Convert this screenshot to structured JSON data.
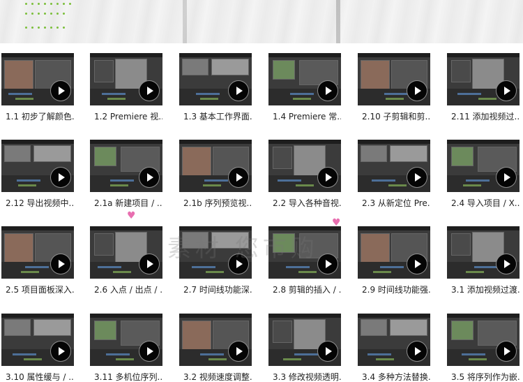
{
  "colors": {
    "accent_dots": "#7bbf3a",
    "play_button": "#050505",
    "thumb_bg": "#3b3b3b",
    "caption": "#222222"
  },
  "icons": {
    "play": "play-icon",
    "heart": "heart-icon"
  },
  "lessons": [
    {
      "title": "1.1 初步了解颜色..."
    },
    {
      "title": "1.2 Premiere 视..."
    },
    {
      "title": "1.3 基本工作界面..."
    },
    {
      "title": "1.4 Premiere 常..."
    },
    {
      "title": "2.10 子剪辑和剪..."
    },
    {
      "title": "2.11 添加视频过..."
    },
    {
      "title": "2.12 导出视频中..."
    },
    {
      "title": "2.1a 新建项目 / ..."
    },
    {
      "title": "2.1b 序列预览视..."
    },
    {
      "title": "2.2 导入各种音视..."
    },
    {
      "title": "2.3 从新定位 Pre..."
    },
    {
      "title": "2.4 导入项目 / X..."
    },
    {
      "title": "2.5 项目面板深入..."
    },
    {
      "title": "2.6 入点 / 出点 / ..."
    },
    {
      "title": "2.7 时间线功能深..."
    },
    {
      "title": "2.8 剪辑的插入 / ..."
    },
    {
      "title": "2.9 时间线功能强..."
    },
    {
      "title": "3.1 添加视频过渡..."
    },
    {
      "title": "3.10 属性缓与 / ..."
    },
    {
      "title": "3.11 多机位序列..."
    },
    {
      "title": "3.2 视频速度调整..."
    },
    {
      "title": "3.3 修改视频透明..."
    },
    {
      "title": "3.4 多种方法替换..."
    },
    {
      "title": "3.5 将序列作为嵌..."
    }
  ]
}
